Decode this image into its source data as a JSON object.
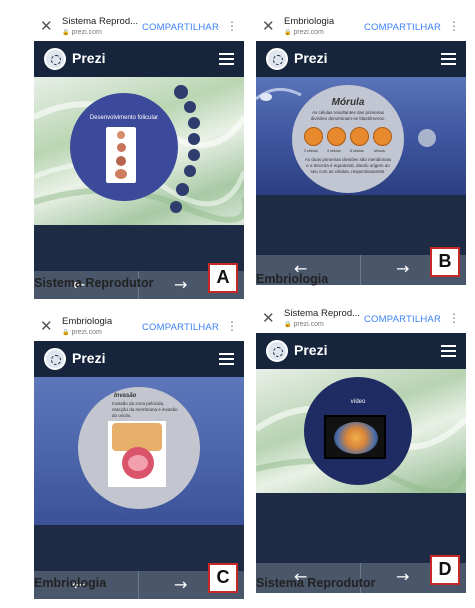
{
  "browser": {
    "share_label": "COMPARTILHAR",
    "url": "prezi.com"
  },
  "brand": "Prezi",
  "arrows": {
    "prev": "←",
    "next": "→"
  },
  "panels": [
    {
      "letter": "A",
      "tab_title": "Sistema Reprod...",
      "slide_title": "Desenvolvimento folicular",
      "caption": "Sistema Reprodutor"
    },
    {
      "letter": "B",
      "tab_title": "Embriologia",
      "slide_title": "Mórula",
      "slide_text_1": "As células resultantes das primeiras divisões denominam-se blastômeros.",
      "cell_labels": [
        "2 células",
        "4 células",
        "8 células",
        "Mórula"
      ],
      "slide_text_2": "As duas primeiras divisões são meridionais e a terceira é equatorial, dando origem ao seu com as células, respectivamente.",
      "caption": "Embriologia"
    },
    {
      "letter": "C",
      "tab_title": "Embriologia",
      "slide_title": "Invasão",
      "slide_text_1": "Invasão da zona pelúcida, reacção da membrana e invasão do oócito.",
      "caption": "Embriologia"
    },
    {
      "letter": "D",
      "tab_title": "Sistema Reprod...",
      "slide_title": "vídeo",
      "caption": "Sistema Reprodutor"
    }
  ],
  "colors": {
    "navbar": "#16253c",
    "share": "#3b82f6",
    "letter_border": "#c62828"
  }
}
